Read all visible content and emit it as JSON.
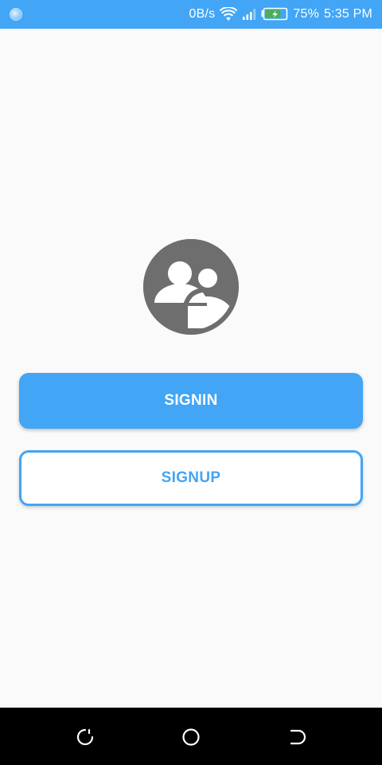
{
  "status_bar": {
    "network_speed": "0B/s",
    "battery_percent": "75%",
    "time": "5:35 PM",
    "icons": [
      "notification-dot-icon",
      "wifi-icon",
      "cell-signal-icon",
      "battery-charging-icon"
    ],
    "battery_level": 0.75
  },
  "logo": {
    "icon": "people-group-icon"
  },
  "buttons": {
    "signin_label": "SIGNIN",
    "signup_label": "SIGNUP"
  },
  "nav_bar": {
    "icons": [
      "back-icon",
      "home-icon",
      "recent-apps-icon"
    ]
  },
  "colors": {
    "accent": "#42a5f5",
    "background": "#fafafa",
    "logo": "#6e6e6e",
    "nav_bar": "#000000"
  }
}
